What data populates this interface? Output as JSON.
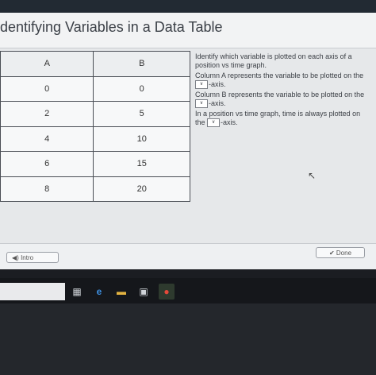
{
  "header": {
    "title": "dentifying Variables in a Data Table"
  },
  "table": {
    "columns": [
      "A",
      "B"
    ],
    "rows": [
      [
        "0",
        "0"
      ],
      [
        "2",
        "5"
      ],
      [
        "4",
        "10"
      ],
      [
        "6",
        "15"
      ],
      [
        "8",
        "20"
      ]
    ]
  },
  "question": {
    "intro": "Identify which variable is plotted on each axis of a position vs time graph.",
    "line1": "Column A represents the variable to be plotted on the",
    "line1_suffix": "-axis.",
    "line2": "Column B represents the variable to be plotted on the",
    "line2_suffix": "-axis.",
    "line3": "In a position vs time graph, time is always plotted on the",
    "line3_suffix": "-axis.",
    "dropdown_glyph": "∨"
  },
  "footer": {
    "intro_label": "Intro",
    "done_label": "Done"
  },
  "icons": {
    "speaker": "speaker-icon",
    "check": "check-icon",
    "cursor": "cursor-icon"
  }
}
